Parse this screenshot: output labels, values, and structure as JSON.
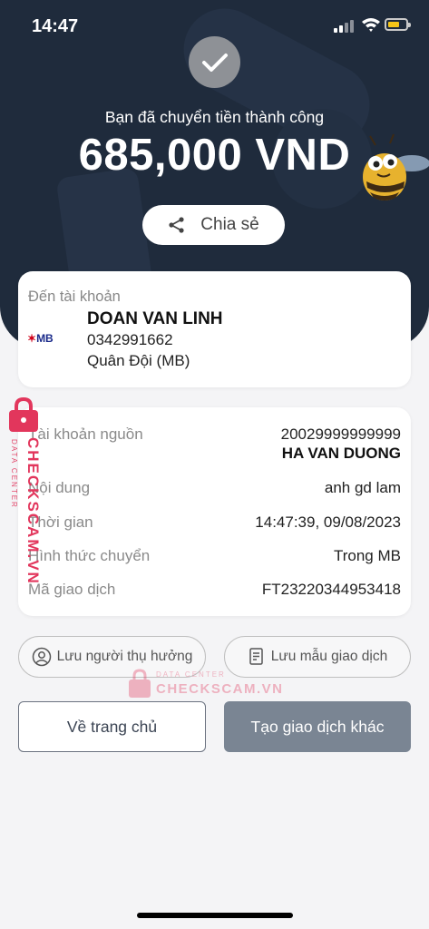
{
  "status_bar": {
    "time": "14:47"
  },
  "header": {
    "success_message": "Bạn đã chuyển tiền thành công",
    "amount": "685,000 VND",
    "share_label": "Chia sẻ"
  },
  "destination": {
    "label": "Đến tài khoản",
    "bank_logo": "MB",
    "name": "DOAN VAN LINH",
    "account": "0342991662",
    "bank": "Quân Đội (MB)"
  },
  "details": {
    "rows": [
      {
        "label": "Tài khoản nguồn",
        "value": "20029999999999",
        "value2": "HA VAN DUONG"
      },
      {
        "label": "Nội dung",
        "value": "anh gd lam"
      },
      {
        "label": "Thời gian",
        "value": "14:47:39, 09/08/2023"
      },
      {
        "label": "Hình thức chuyển",
        "value": "Trong MB"
      },
      {
        "label": "Mã giao dịch",
        "value": "FT23220344953418"
      }
    ]
  },
  "actions": {
    "save_beneficiary": "Lưu người thụ hưởng",
    "save_template": "Lưu mẫu giao dịch",
    "home": "Về trang chủ",
    "new_transaction": "Tạo giao dịch khác"
  },
  "watermark": {
    "small": "DATA CENTER",
    "big": "CHECKSCAM.VN"
  },
  "colors": {
    "hero": "#1f2b3c",
    "accent_button": "#7a8593",
    "watermark": "#e2365c",
    "battery": "#f5c518"
  }
}
